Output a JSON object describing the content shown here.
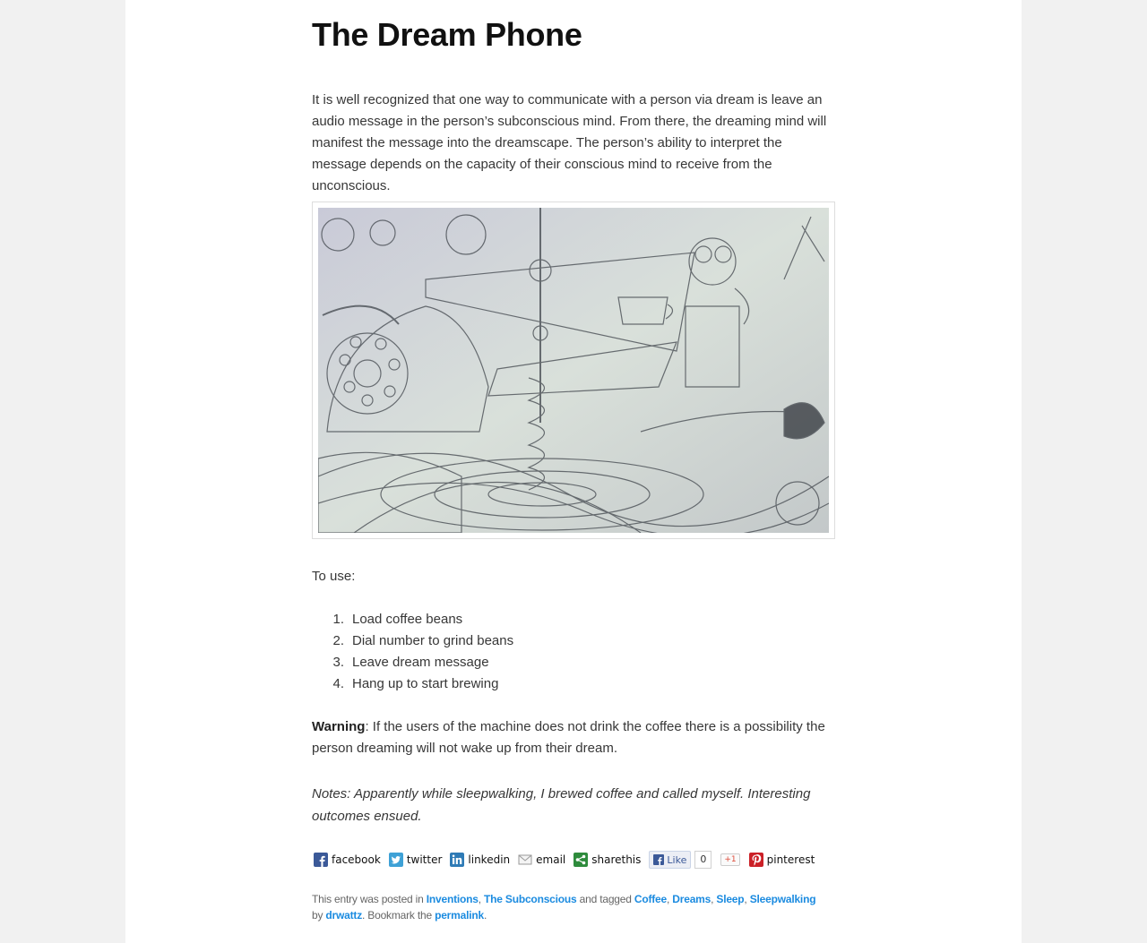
{
  "post": {
    "title": "The Dream Phone",
    "intro": "It is well recognized that one way to communicate with a person via dream is leave an audio message in the person’s subconscious mind. From there, the dreaming mind will manifest the message into the dreamscape. The person’s ability to interpret the message depends on the capacity of their conscious mind to receive from the unconscious.",
    "image_icon": "pencil-sketch-illustration",
    "to_use_label": "To use:",
    "steps": [
      {
        "num": "1.",
        "text": "Load coffee beans"
      },
      {
        "num": "2.",
        "text": "Dial number to grind beans"
      },
      {
        "num": "3.",
        "text": "Leave dream message"
      },
      {
        "num": "4.",
        "text": "Hang up to start brewing"
      }
    ],
    "warning_label": "Warning",
    "warning_text": ": If the users of the machine does not drink the coffee there is a possibility the person dreaming will not wake up from their dream.",
    "notes": "Notes: Apparently while sleepwalking, I brewed coffee and called myself. Interesting outcomes ensued."
  },
  "share": {
    "facebook": "facebook",
    "twitter": "twitter",
    "linkedin": "linkedin",
    "email": "email",
    "sharethis": "sharethis",
    "like_label": "Like",
    "like_count": "0",
    "gplus_label": "+1",
    "pinterest": "pinterest"
  },
  "meta": {
    "posted_in": "This entry was posted in",
    "cat1": "Inventions",
    "sep1": ",",
    "cat2": "The Subconscious",
    "tagged": "and tagged",
    "tag1": "Coffee",
    "tag2": "Dreams",
    "tag3": "Sleep",
    "tag4": "Sleepwalking",
    "by": "by",
    "author": "drwattz",
    "bookmark": ". Bookmark the",
    "permalink": "permalink",
    "end": "."
  },
  "colors": {
    "link": "#1b8be0",
    "page_bg": "#f1f1f1",
    "content_bg": "#ffffff",
    "text": "#373737"
  }
}
